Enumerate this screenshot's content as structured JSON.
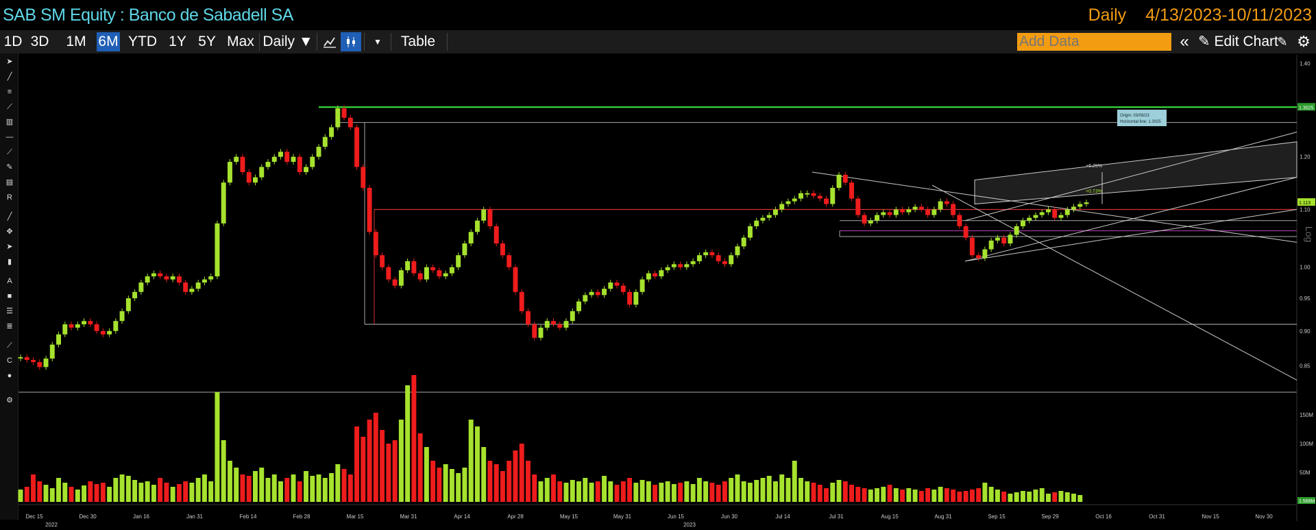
{
  "header": {
    "title": "SAB SM Equity : Banco de Sabadell SA",
    "period": "Daily",
    "date_range": "4/13/2023-10/11/2023"
  },
  "toolbar": {
    "ranges": [
      "1D",
      "3D",
      "1M",
      "6M",
      "YTD",
      "1Y",
      "5Y",
      "Max"
    ],
    "active_range": "6M",
    "frequency": "Daily ▼",
    "table_label": "Table",
    "add_data_placeholder": "Add Data",
    "edit_chart_label": "Edit Chart"
  },
  "colors": {
    "up": "#a6e22e",
    "down": "#ee1c1c",
    "accent": "#f39c12",
    "title": "#5fd7e8",
    "active_button": "#1f5fb5"
  },
  "chart_data": {
    "type": "candlestick",
    "scale": "log",
    "scale_label": "Log",
    "ylim": [
      0.82,
      1.42
    ],
    "y_ticks": [
      1.4,
      1.3,
      1.2,
      1.1,
      1.0,
      0.95,
      0.9,
      0.85
    ],
    "x_ticks": [
      "Dec 15",
      "Dec 30",
      "Jan 16",
      "Jan 31",
      "Feb 14",
      "Feb 28",
      "Mar 15",
      "Mar 31",
      "Apr 14",
      "Apr 28",
      "May 15",
      "May 31",
      "Jun 15",
      "Jun 30",
      "Jul 14",
      "Jul 31",
      "Aug 15",
      "Aug 31",
      "Sep 15",
      "Sep 29",
      "Oct 16",
      "Oct 31",
      "Nov 15",
      "Nov 30"
    ],
    "year_labels": [
      "2022",
      "2023"
    ],
    "price_markers": {
      "horizontal_line": "1.3025",
      "last_price": "1.113"
    },
    "annotations": {
      "tooltip_line1": "Origin: 03/09/23",
      "tooltip_line2": "Horizontal line: 1.3025",
      "pct_top": "+6.25%",
      "pct_bottom": "+0.73%"
    },
    "closes": [
      0.862,
      0.858,
      0.855,
      0.848,
      0.86,
      0.88,
      0.895,
      0.91,
      0.905,
      0.91,
      0.915,
      0.91,
      0.9,
      0.895,
      0.9,
      0.915,
      0.93,
      0.95,
      0.96,
      0.975,
      0.985,
      0.99,
      0.985,
      0.98,
      0.985,
      0.975,
      0.96,
      0.965,
      0.975,
      0.98,
      0.985,
      1.075,
      1.15,
      1.19,
      1.2,
      1.17,
      1.15,
      1.16,
      1.18,
      1.19,
      1.2,
      1.21,
      1.19,
      1.2,
      1.17,
      1.18,
      1.2,
      1.22,
      1.24,
      1.26,
      1.3,
      1.28,
      1.26,
      1.18,
      1.14,
      1.06,
      1.02,
      1.0,
      0.98,
      0.97,
      0.995,
      1.01,
      0.99,
      0.98,
      1.0,
      0.995,
      0.985,
      0.99,
      1.0,
      1.02,
      1.04,
      1.06,
      1.08,
      1.1,
      1.07,
      1.04,
      1.02,
      1.0,
      0.96,
      0.93,
      0.91,
      0.89,
      0.905,
      0.915,
      0.91,
      0.905,
      0.915,
      0.93,
      0.945,
      0.955,
      0.96,
      0.955,
      0.965,
      0.975,
      0.97,
      0.96,
      0.94,
      0.96,
      0.98,
      0.99,
      0.985,
      0.995,
      1.0,
      1.005,
      1.0,
      1.005,
      1.01,
      1.02,
      1.025,
      1.02,
      1.01,
      1.005,
      1.02,
      1.035,
      1.05,
      1.07,
      1.08,
      1.085,
      1.09,
      1.1,
      1.11,
      1.115,
      1.12,
      1.13,
      1.13,
      1.125,
      1.12,
      1.11,
      1.14,
      1.165,
      1.15,
      1.12,
      1.09,
      1.075,
      1.08,
      1.09,
      1.095,
      1.09,
      1.1,
      1.095,
      1.1,
      1.105,
      1.1,
      1.09,
      1.1,
      1.115,
      1.11,
      1.09,
      1.07,
      1.05,
      1.02,
      1.015,
      1.03,
      1.045,
      1.05,
      1.04,
      1.055,
      1.07,
      1.08,
      1.085,
      1.09,
      1.095,
      1.1,
      1.085,
      1.09,
      1.1,
      1.105,
      1.11,
      1.113
    ],
    "volume_axis_ticks": [
      "150M",
      "100M",
      "50M"
    ],
    "volume_last": "1.568M",
    "volumes": [
      18,
      22,
      40,
      30,
      25,
      20,
      35,
      28,
      22,
      18,
      24,
      30,
      26,
      28,
      22,
      35,
      40,
      38,
      32,
      28,
      30,
      25,
      35,
      28,
      22,
      26,
      30,
      28,
      35,
      40,
      30,
      160,
      90,
      60,
      50,
      40,
      38,
      45,
      50,
      35,
      40,
      30,
      35,
      40,
      30,
      45,
      38,
      40,
      35,
      42,
      55,
      48,
      40,
      110,
      95,
      120,
      130,
      105,
      85,
      90,
      120,
      170,
      185,
      100,
      80,
      60,
      50,
      55,
      48,
      42,
      50,
      120,
      110,
      80,
      60,
      55,
      45,
      60,
      75,
      85,
      60,
      40,
      30,
      35,
      40,
      30,
      28,
      32,
      30,
      35,
      28,
      30,
      38,
      30,
      25,
      30,
      35,
      28,
      32,
      30,
      25,
      28,
      30,
      26,
      28,
      30,
      26,
      35,
      30,
      28,
      25,
      30,
      35,
      40,
      30,
      28,
      32,
      35,
      38,
      30,
      40,
      35,
      60,
      35,
      30,
      28,
      25,
      20,
      28,
      32,
      30,
      25,
      22,
      20,
      18,
      20,
      22,
      25,
      20,
      18,
      20,
      18,
      16,
      20,
      18,
      22,
      20,
      18,
      15,
      16,
      18,
      20,
      28,
      22,
      18,
      15,
      12,
      14,
      16,
      15,
      18,
      20,
      12,
      14,
      16,
      14,
      12,
      10
    ]
  }
}
